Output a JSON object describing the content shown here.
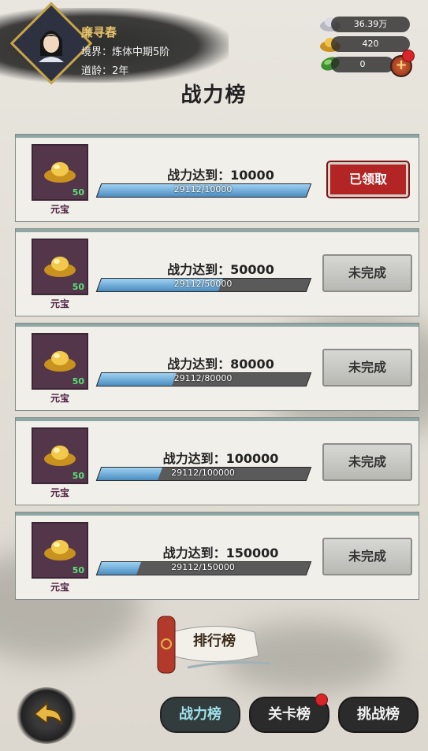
{
  "player": {
    "name": "廉寻春",
    "realm": "境界：炼体中期5阶",
    "age": "道龄：2年"
  },
  "resources": {
    "silver": "36.39万",
    "gold": "420",
    "jade": "0"
  },
  "page_title": "战力榜",
  "rows": [
    {
      "reward_count": "50",
      "reward_name": "元宝",
      "target_label": "战力达到：10000",
      "progress_text": "29112/10000",
      "progress": 1.0,
      "button": "已领取",
      "state": "claimed"
    },
    {
      "reward_count": "50",
      "reward_name": "元宝",
      "target_label": "战力达到：50000",
      "progress_text": "29112/50000",
      "progress": 0.58,
      "button": "未完成",
      "state": "incomplete"
    },
    {
      "reward_count": "50",
      "reward_name": "元宝",
      "target_label": "战力达到：80000",
      "progress_text": "29112/80000",
      "progress": 0.36,
      "button": "未完成",
      "state": "incomplete"
    },
    {
      "reward_count": "50",
      "reward_name": "元宝",
      "target_label": "战力达到：100000",
      "progress_text": "29112/100000",
      "progress": 0.29,
      "button": "未完成",
      "state": "incomplete"
    },
    {
      "reward_count": "50",
      "reward_name": "元宝",
      "target_label": "战力达到：150000",
      "progress_text": "29112/150000",
      "progress": 0.19,
      "button": "未完成",
      "state": "incomplete"
    }
  ],
  "ranking_button": "排行榜",
  "tabs": [
    {
      "label": "战力榜",
      "active": true
    },
    {
      "label": "关卡榜",
      "active": false
    },
    {
      "label": "挑战榜",
      "active": false
    }
  ],
  "icons": {
    "back": "back-arrow-icon",
    "reward": "gold-ingot-icon"
  },
  "colors": {
    "progress_fill": "#4a8cc0",
    "claimed_button": "#b32424",
    "active_tab_text": "#9fe0ea"
  }
}
